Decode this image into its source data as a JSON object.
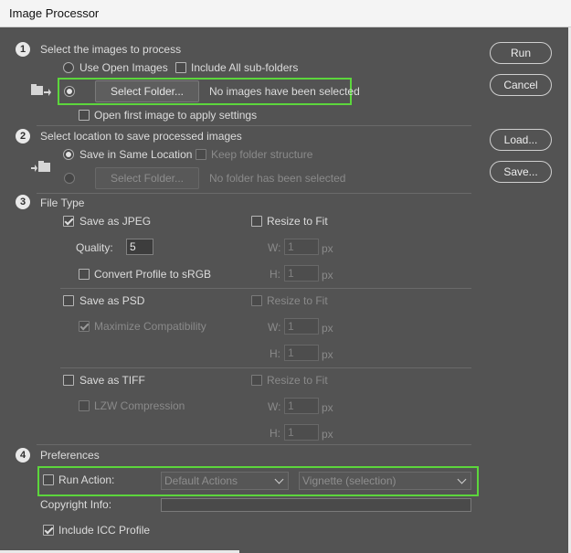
{
  "window": {
    "title": "Image Processor"
  },
  "buttons": {
    "run": "Run",
    "cancel": "Cancel",
    "load": "Load...",
    "save": "Save..."
  },
  "section1": {
    "number": "1",
    "title": "Select the images to process",
    "use_open_images": "Use Open Images",
    "include_subfolders": "Include All sub-folders",
    "select_folder": "Select Folder...",
    "status": "No images have been selected",
    "open_first_image": "Open first image to apply settings"
  },
  "section2": {
    "number": "2",
    "title": "Select location to save processed images",
    "save_same_location": "Save in Same Location",
    "keep_structure": "Keep folder structure",
    "select_folder": "Select Folder...",
    "status": "No folder has been selected"
  },
  "section3": {
    "number": "3",
    "title": "File Type",
    "jpeg": {
      "label": "Save as JPEG",
      "checked": true,
      "resize": "Resize to Fit",
      "quality_label": "Quality:",
      "quality_value": "5",
      "convert_profile": "Convert Profile to sRGB",
      "w_label": "W:",
      "w_value": "1",
      "w_unit": "px",
      "h_label": "H:",
      "h_value": "1",
      "h_unit": "px"
    },
    "psd": {
      "label": "Save as PSD",
      "resize": "Resize to Fit",
      "maximize": "Maximize Compatibility",
      "w_label": "W:",
      "w_value": "1",
      "w_unit": "px",
      "h_label": "H:",
      "h_value": "1",
      "h_unit": "px"
    },
    "tiff": {
      "label": "Save as TIFF",
      "resize": "Resize to Fit",
      "lzw": "LZW Compression",
      "w_label": "W:",
      "w_value": "1",
      "w_unit": "px",
      "h_label": "H:",
      "h_value": "1",
      "h_unit": "px"
    }
  },
  "section4": {
    "number": "4",
    "title": "Preferences",
    "run_action": "Run Action:",
    "action_set": "Default Actions",
    "action": "Vignette (selection)",
    "copyright_label": "Copyright Info:",
    "copyright_value": "",
    "include_icc": "Include ICC Profile"
  },
  "colors": {
    "background": "#535353",
    "highlight": "#5cd63c",
    "titlebar": "#f4f4f4"
  }
}
